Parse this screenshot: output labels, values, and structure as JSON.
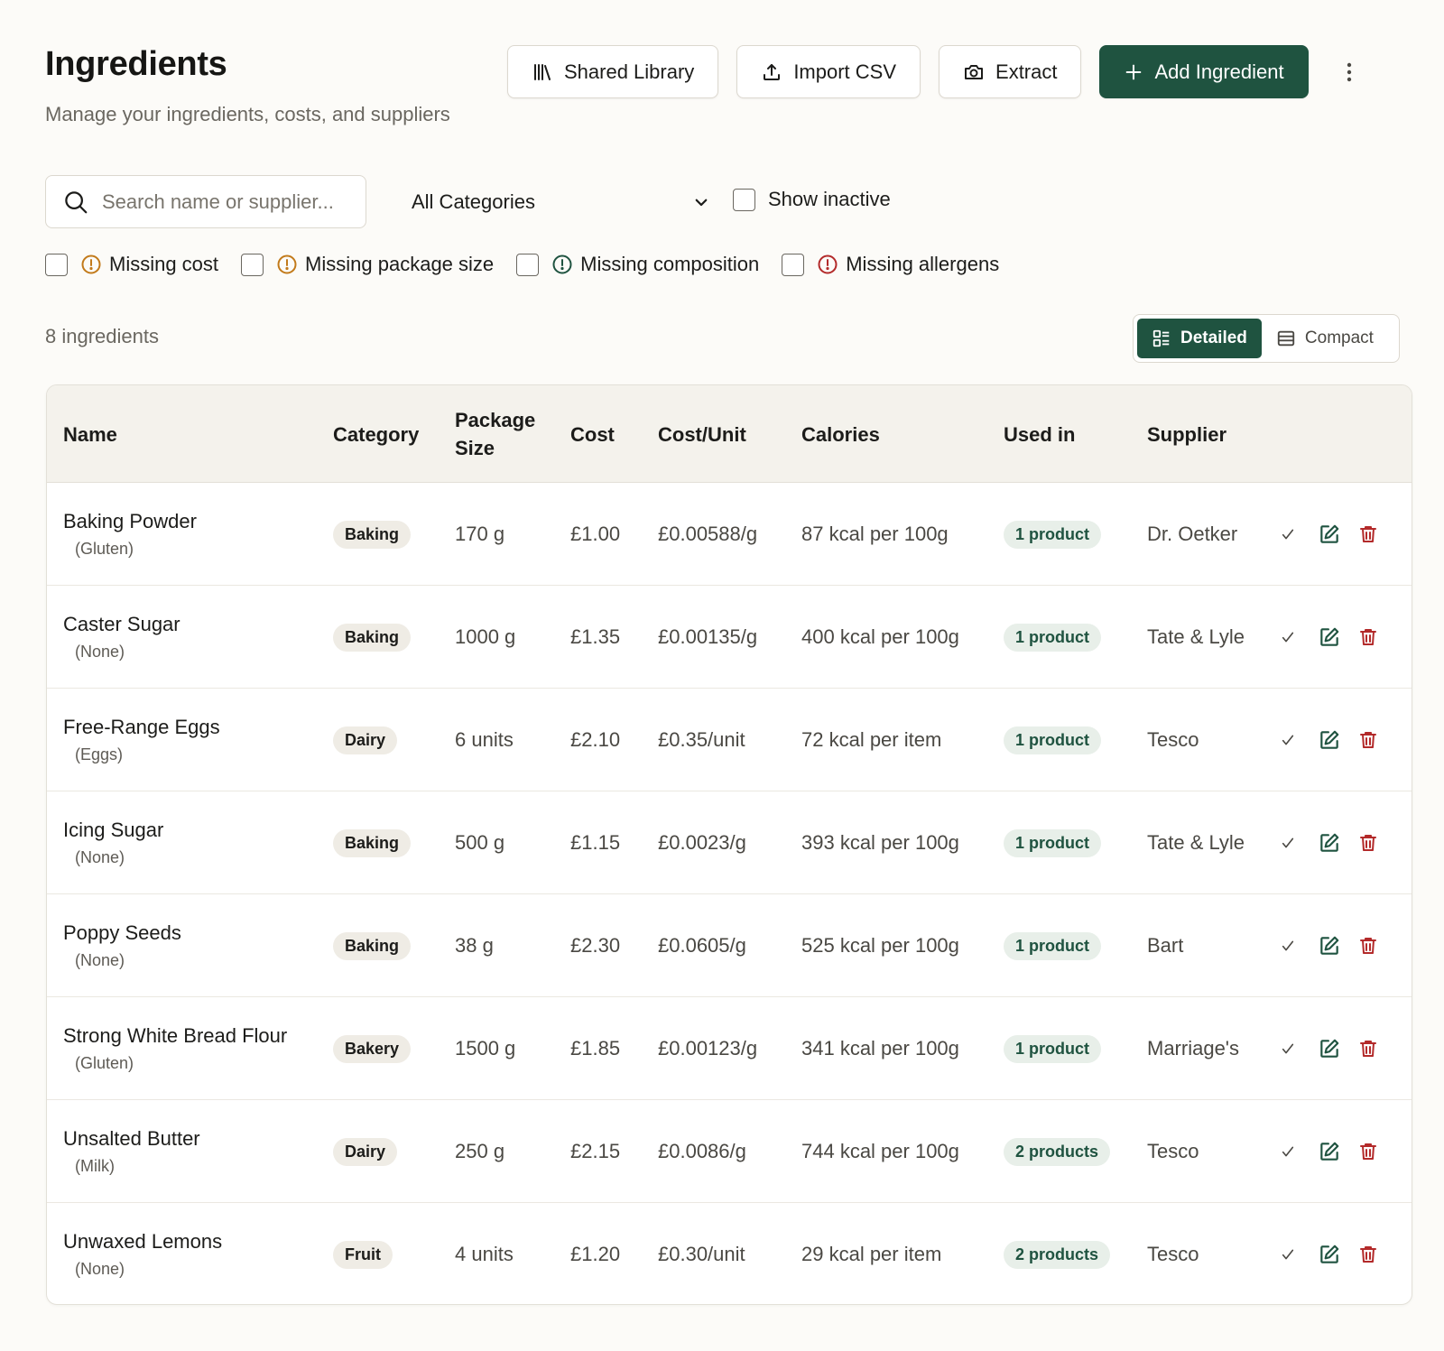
{
  "header": {
    "title": "Ingredients",
    "subtitle": "Manage your ingredients, costs, and suppliers",
    "buttons": {
      "shared_library": "Shared Library",
      "import_csv": "Import CSV",
      "extract": "Extract",
      "add_ingredient": "Add Ingredient"
    }
  },
  "filters": {
    "search_placeholder": "Search name or supplier...",
    "search_value": "",
    "category_selected": "All Categories",
    "show_inactive_label": "Show inactive",
    "missing": [
      {
        "label": "Missing cost",
        "color": "#c27a1a"
      },
      {
        "label": "Missing package size",
        "color": "#c27a1a"
      },
      {
        "label": "Missing composition",
        "color": "#1f5340"
      },
      {
        "label": "Missing allergens",
        "color": "#b32a2a"
      }
    ]
  },
  "summary": {
    "count_label": "8 ingredients"
  },
  "view_toggle": {
    "detailed": "Detailed",
    "compact": "Compact",
    "active": "detailed"
  },
  "colors": {
    "accent": "#1f5340",
    "danger": "#b32a2a",
    "warning": "#c27a1a"
  },
  "table": {
    "headers": {
      "name": "Name",
      "category": "Category",
      "package_size_line1": "Package",
      "package_size_line2": "Size",
      "cost": "Cost",
      "cost_unit": "Cost/Unit",
      "calories": "Calories",
      "used_in": "Used in",
      "supplier": "Supplier"
    },
    "rows": [
      {
        "name": "Baking Powder",
        "allergen": "(Gluten)",
        "category": "Baking",
        "package_size": "170 g",
        "cost": "£1.00",
        "cost_unit": "£0.00588/g",
        "calories": "87 kcal per 100g",
        "used_in": "1 product",
        "supplier": "Dr. Oetker"
      },
      {
        "name": "Caster Sugar",
        "allergen": "(None)",
        "category": "Baking",
        "package_size": "1000 g",
        "cost": "£1.35",
        "cost_unit": "£0.00135/g",
        "calories": "400 kcal per 100g",
        "used_in": "1 product",
        "supplier": "Tate & Lyle"
      },
      {
        "name": "Free-Range Eggs",
        "allergen": "(Eggs)",
        "category": "Dairy",
        "package_size": "6 units",
        "cost": "£2.10",
        "cost_unit": "£0.35/unit",
        "calories": "72 kcal per item",
        "used_in": "1 product",
        "supplier": "Tesco"
      },
      {
        "name": "Icing Sugar",
        "allergen": "(None)",
        "category": "Baking",
        "package_size": "500 g",
        "cost": "£1.15",
        "cost_unit": "£0.0023/g",
        "calories": "393 kcal per 100g",
        "used_in": "1 product",
        "supplier": "Tate & Lyle"
      },
      {
        "name": "Poppy Seeds",
        "allergen": "(None)",
        "category": "Baking",
        "package_size": "38 g",
        "cost": "£2.30",
        "cost_unit": "£0.0605/g",
        "calories": "525 kcal per 100g",
        "used_in": "1 product",
        "supplier": "Bart"
      },
      {
        "name": "Strong White Bread Flour",
        "allergen": "(Gluten)",
        "category": "Bakery",
        "package_size": "1500 g",
        "cost": "£1.85",
        "cost_unit": "£0.00123/g",
        "calories": "341 kcal per 100g",
        "used_in": "1 product",
        "supplier": "Marriage's"
      },
      {
        "name": "Unsalted Butter",
        "allergen": "(Milk)",
        "category": "Dairy",
        "package_size": "250 g",
        "cost": "£2.15",
        "cost_unit": "£0.0086/g",
        "calories": "744 kcal per 100g",
        "used_in": "2 products",
        "supplier": "Tesco"
      },
      {
        "name": "Unwaxed Lemons",
        "allergen": "(None)",
        "category": "Fruit",
        "package_size": "4 units",
        "cost": "£1.20",
        "cost_unit": "£0.30/unit",
        "calories": "29 kcal per item",
        "used_in": "2 products",
        "supplier": "Tesco"
      }
    ]
  }
}
